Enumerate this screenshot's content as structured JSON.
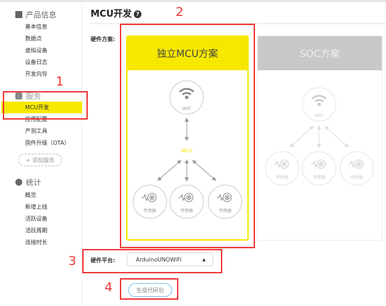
{
  "sidebar": {
    "sections": [
      {
        "title": "产品信息",
        "icon": "grid-icon",
        "items": [
          "基本信息",
          "数据点",
          "虚拟设备",
          "设备日志",
          "开发向导"
        ]
      },
      {
        "title": "服务",
        "icon": "service-icon",
        "items": [
          "MCU开发",
          "应用配置",
          "产测工具",
          "固件升级（OTA）"
        ],
        "add_label": "+ 添加服务"
      },
      {
        "title": "统计",
        "icon": "pie-chart-icon",
        "items": [
          "概览",
          "新增上线",
          "活跃设备",
          "活跃周期",
          "连接时长"
        ]
      }
    ],
    "active": "MCU开发"
  },
  "main": {
    "title": "MCU开发",
    "help": "?",
    "scheme_label": "硬件方案:",
    "schemes": [
      {
        "label": "独立MCU方案",
        "selected": true,
        "wifi": "WiFi",
        "mcu": "MCU",
        "sensor": "传感器"
      },
      {
        "label": "SOC方案",
        "selected": false,
        "wifi": "WiFi",
        "sensor": "传感器"
      }
    ],
    "platform_label": "硬件平台:",
    "platform_value": "ArduinoUNOWiFi",
    "generate_button": "生成代码包"
  },
  "annotations": [
    "1",
    "2",
    "3",
    "4"
  ],
  "colors": {
    "accent": "#f7e800",
    "annotation": "#f03a3a",
    "button_border": "#7cc4ee"
  }
}
